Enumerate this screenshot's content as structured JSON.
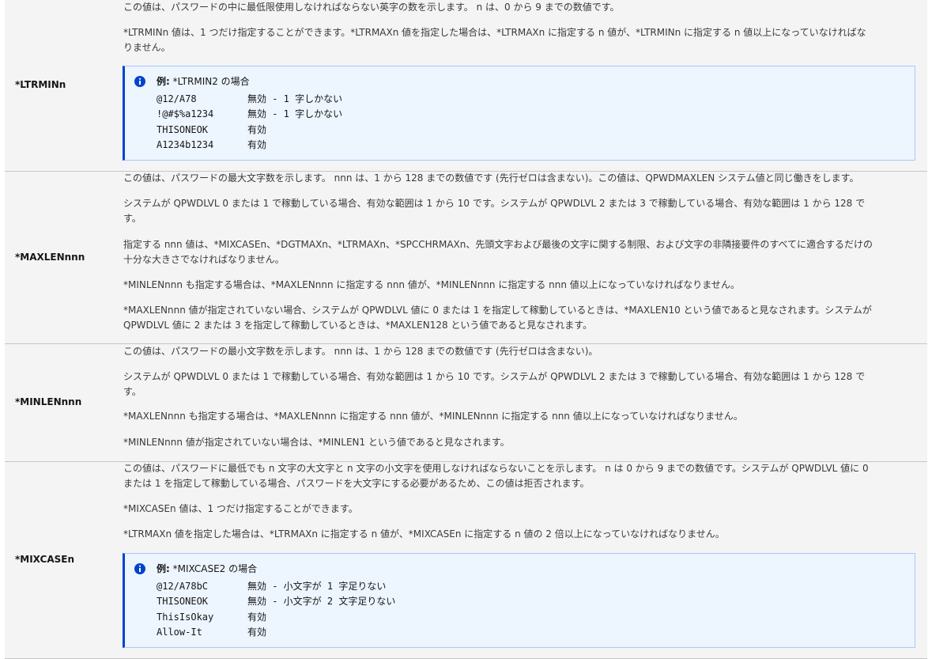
{
  "rows": [
    {
      "key": "*LTRMINn",
      "paras": [
        "この値は、パスワードの中に最低限使用しなければならない英字の数を示します。 n は、0 から 9 までの数値です。",
        "*LTRMINn 値は、1 つだけ指定することができます。*LTRMAXn 値を指定した場合は、*LTRMAXn に指定する n 値が、*LTRMINn に指定する n 値以上になっていなければな",
        "りません。"
      ],
      "example": {
        "label": "例:",
        "title": "*LTRMIN2 の場合",
        "lines": [
          {
            "code": "@12/A78",
            "result": "無効 - 1 字しかない"
          },
          {
            "code": "!@#$%a1234",
            "result": "無効 - 1 字しかない"
          },
          {
            "code": "THISONEOK",
            "result": "有効"
          },
          {
            "code": "A1234b1234",
            "result": "有効"
          }
        ]
      }
    },
    {
      "key": "*MAXLENnnn",
      "paras": [
        "この値は、パスワードの最大文字数を示します。 nnn は、1 から 128 までの数値です (先行ゼロは含まない)。この値は、QPWDMAXLEN システム値と同じ働きをします。",
        "システムが QPWDLVL 0 または 1 で稼動している場合、有効な範囲は 1 から 10 です。システムが QPWDLVL 2 または 3 で稼動している場合、有効な範囲は 1 から 128 で",
        "す。",
        "指定する nnn 値は、*MIXCASEn、*DGTMAXn、*LTRMAXn、*SPCCHRMAXn、先頭文字および最後の文字に関する制限、および文字の非隣接要件のすべてに適合するだけの",
        "十分な大きさでなければなりません。",
        "*MINLENnnn も指定する場合は、*MAXLENnnn に指定する nnn 値が、*MINLENnnn に指定する nnn 値以上になっていなければなりません。",
        "*MAXLENnnn 値が指定されていない場合、システムが QPWDLVL 値に 0 または 1 を指定して稼動しているときは、*MAXLEN10 という値であると見なされます。システムが",
        "QPWDLVL 値に 2 または 3 を指定して稼動しているときは、*MAXLEN128 という値であると見なされます。"
      ]
    },
    {
      "key": "*MINLENnnn",
      "paras": [
        "この値は、パスワードの最小文字数を示します。 nnn は、1 から 128 までの数値です (先行ゼロは含まない)。",
        "システムが QPWDLVL 0 または 1 で稼動している場合、有効な範囲は 1 から 10 です。システムが QPWDLVL 2 または 3 で稼動している場合、有効な範囲は 1 から 128 で",
        "す。",
        "*MAXLENnnn も指定する場合は、*MAXLENnnn に指定する nnn 値が、*MINLENnnn に指定する nnn 値以上になっていなければなりません。",
        "*MINLENnnn 値が指定されていない場合は、*MINLEN1 という値であると見なされます。"
      ]
    },
    {
      "key": "*MIXCASEn",
      "paras": [
        "この値は、パスワードに最低でも n 文字の大文字と n 文字の小文字を使用しなければならないことを示します。 n は 0 から 9 までの数値です。システムが QPWDLVL 値に 0",
        "または 1 を指定して稼動している場合、パスワードを大文字にする必要があるため、この値は拒否されます。",
        "*MIXCASEn 値は、1 つだけ指定することができます。",
        "*LTRMAXn 値を指定した場合は、*LTRMAXn に指定する n 値が、*MIXCASEn に指定する n 値の 2 倍以上になっていなければなりません。"
      ],
      "example": {
        "label": "例:",
        "title": "*MIXCASE2 の場合",
        "lines": [
          {
            "code": "@12/A78bC",
            "result": "無効 - 小文字が 1 字足りない"
          },
          {
            "code": "THISONEOK",
            "result": "無効 - 小文字が 2 文字足りない"
          },
          {
            "code": "ThisIsOkay",
            "result": "有効"
          },
          {
            "code": "Allow-It",
            "result": "有効"
          }
        ]
      }
    }
  ],
  "colors": {
    "row_bg": "#f4f4f4",
    "divider": "#c6c6c6",
    "note_bg": "#edf5ff",
    "note_border": "#0043ce",
    "info_icon": "#0043ce"
  },
  "icons": [
    "info-icon"
  ]
}
